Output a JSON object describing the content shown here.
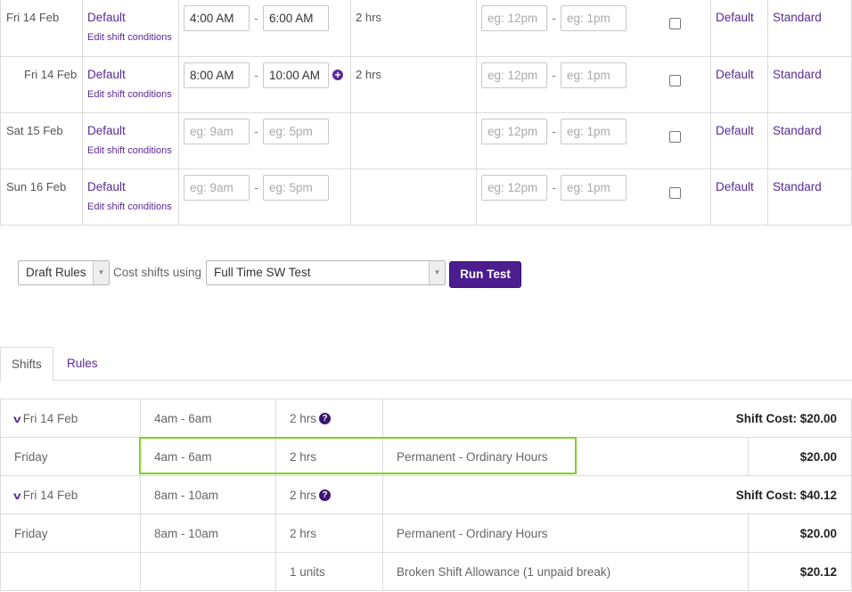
{
  "shifts": [
    {
      "date": "Fri 14 Feb",
      "condition": "Default",
      "edit_label": "Edit shift conditions",
      "start": "4:00 AM",
      "end": "6:00 AM",
      "start_placeholder": "",
      "end_placeholder": "",
      "hours": "2 hrs",
      "break_start_placeholder": "eg: 12pm",
      "break_end_placeholder": "eg: 1pm",
      "col_default": "Default",
      "col_standard": "Standard",
      "has_add": false
    },
    {
      "date": "Fri 14 Feb",
      "condition": "Default",
      "edit_label": "Edit shift conditions",
      "start": "8:00 AM",
      "end": "10:00 AM",
      "start_placeholder": "",
      "end_placeholder": "",
      "hours": "2 hrs",
      "break_start_placeholder": "eg: 12pm",
      "break_end_placeholder": "eg: 1pm",
      "col_default": "Default",
      "col_standard": "Standard",
      "has_add": true
    },
    {
      "date": "Sat 15 Feb",
      "condition": "Default",
      "edit_label": "Edit shift conditions",
      "start": "",
      "end": "",
      "start_placeholder": "eg: 9am",
      "end_placeholder": "eg: 5pm",
      "hours": "",
      "break_start_placeholder": "eg: 12pm",
      "break_end_placeholder": "eg: 1pm",
      "col_default": "Default",
      "col_standard": "Standard",
      "has_add": false
    },
    {
      "date": "Sun 16 Feb",
      "condition": "Default",
      "edit_label": "Edit shift conditions",
      "start": "",
      "end": "",
      "start_placeholder": "eg: 9am",
      "end_placeholder": "eg: 5pm",
      "hours": "",
      "break_start_placeholder": "eg: 12pm",
      "break_end_placeholder": "eg: 1pm",
      "col_default": "Default",
      "col_standard": "Standard",
      "has_add": false
    }
  ],
  "controls": {
    "rules_select": "Draft Rules",
    "cost_label": "Cost shifts using",
    "profile_select": "Full Time SW Test",
    "run_button": "Run Test"
  },
  "tabs": {
    "shifts": "Shifts",
    "rules": "Rules"
  },
  "results": {
    "day1": {
      "label": "Fri 14 Feb",
      "time": "4am - 6am",
      "hours": "2 hrs",
      "shift_cost": "Shift Cost: $20.00"
    },
    "day1_line": {
      "day": "Friday",
      "time": "4am - 6am",
      "hours": "2 hrs",
      "desc": "Permanent - Ordinary Hours",
      "amount": "$20.00"
    },
    "day2": {
      "label": "Fri 14 Feb",
      "time": "8am - 10am",
      "hours": "2 hrs",
      "shift_cost": "Shift Cost: $40.12"
    },
    "day2_line1": {
      "day": "Friday",
      "time": "8am - 10am",
      "hours": "2 hrs",
      "desc": "Permanent - Ordinary Hours",
      "amount": "$20.00"
    },
    "day2_line2": {
      "day": "",
      "time": "",
      "hours": "1 units",
      "desc": "Broken Shift Allowance (1 unpaid break)",
      "amount": "$20.12"
    }
  },
  "colors": {
    "accent": "#5a2a96",
    "button": "#4b1d8f",
    "highlight": "#7ed321"
  }
}
